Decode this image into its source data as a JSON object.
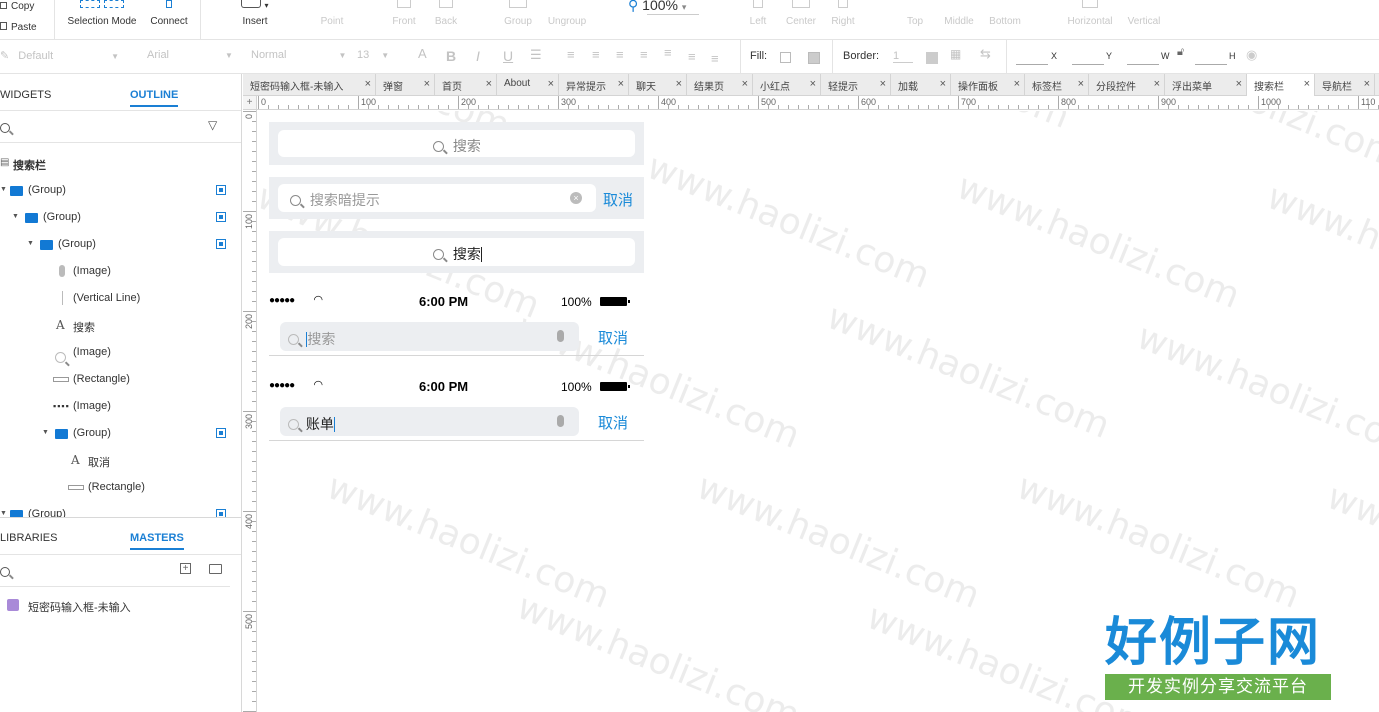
{
  "toolbar": {
    "copy": "Copy",
    "paste": "Paste",
    "selection_mode": "Selection Mode",
    "connect": "Connect",
    "insert": "Insert",
    "point": "Point",
    "front": "Front",
    "back": "Back",
    "group": "Group",
    "ungroup": "Ungroup",
    "zoom": "100%",
    "left": "Left",
    "center": "Center",
    "right": "Right",
    "top": "Top",
    "middle": "Middle",
    "bottom": "Bottom",
    "horizontal": "Horizontal",
    "vertical": "Vertical"
  },
  "format_bar": {
    "style": "Default",
    "font": "Arial",
    "weight": "Normal",
    "size": "13",
    "fill_label": "Fill:",
    "border_label": "Border:",
    "border_value": "1",
    "x_label": "X",
    "y_label": "Y",
    "w_label": "W",
    "h_label": "H"
  },
  "left_panel": {
    "tab_widgets": "WIDGETS",
    "tab_outline": "OUTLINE",
    "page_name": "搜索栏",
    "outline_rows": [
      {
        "label": "(Group)"
      },
      {
        "label": "(Group)"
      },
      {
        "label": "(Group)"
      },
      {
        "label": "(Image)"
      },
      {
        "label": "(Vertical Line)"
      },
      {
        "label": "搜索"
      },
      {
        "label": "(Image)"
      },
      {
        "label": "(Rectangle)"
      },
      {
        "label": "(Image)"
      },
      {
        "label": "(Group)"
      },
      {
        "label": "取消"
      },
      {
        "label": "(Rectangle)"
      },
      {
        "label": "(Group)"
      }
    ],
    "tab_libraries": "LIBRARIES",
    "tab_masters": "MASTERS",
    "master_item": "短密码输入框-未输入"
  },
  "page_tabs": [
    "短密码输入框-未输入",
    "弹窗",
    "首页",
    "About",
    "异常提示",
    "聊天",
    "结果页",
    "小红点",
    "轻提示",
    "加载",
    "操作面板",
    "标签栏",
    "分段控件",
    "浮出菜单",
    "搜索栏",
    "导航栏"
  ],
  "active_tab": "搜索栏",
  "ruler_h": [
    "0",
    "100",
    "200",
    "300",
    "400",
    "500",
    "600",
    "700",
    "800",
    "900",
    "1000",
    "110"
  ],
  "ruler_v": [
    "0",
    "100",
    "200",
    "300",
    "400",
    "500"
  ],
  "canvas": {
    "search1_placeholder": "搜索",
    "search2_placeholder": "搜索暗提示",
    "search2_cancel": "取消",
    "search3_text": "搜索",
    "status_time": "6:00 PM",
    "status_battery": "100%",
    "search4_placeholder": "搜索",
    "search4_cancel": "取消",
    "search5_value": "账单",
    "search5_cancel": "取消"
  },
  "watermark": "www.haolizi.com",
  "logo": {
    "title": "好例子网",
    "subtitle": "开发实例分享交流平台"
  },
  "colors": {
    "accent": "#1a7fd4",
    "cancel_blue": "#1a8ad8",
    "search_bg": "#eceef1"
  }
}
